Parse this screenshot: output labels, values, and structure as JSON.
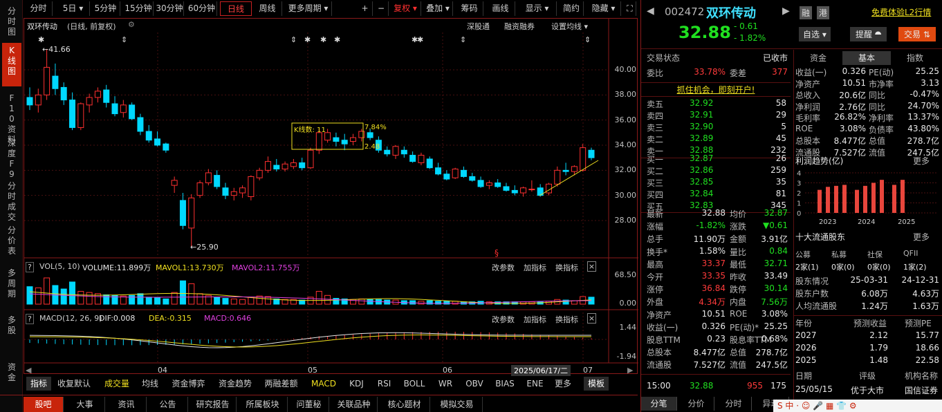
{
  "left_tabs": [
    "分时图",
    "K线图",
    "F10资料",
    "深度F9",
    "分时成交",
    "分价表",
    "多周期",
    "多股",
    "资金"
  ],
  "toolbar": {
    "items": [
      "分时",
      "5日 ▾",
      "5分钟",
      "15分钟",
      "30分钟",
      "60分钟",
      "日线",
      "周线",
      "更多周期 ▾"
    ],
    "right_items": [
      "+",
      "−",
      "复权 ▾",
      "叠加 ▾",
      "筹码",
      "画线",
      "显示 ▾",
      "简约",
      "隐藏 ▾"
    ]
  },
  "chart": {
    "stock_label": "双环传动",
    "mode_label": "(日线, 前复权)",
    "links": [
      "深股通",
      "融资融券",
      "设置均线 ▾"
    ],
    "high_label": "←41.66",
    "low_label": "←25.90",
    "box_label": "K线数: 11",
    "box_pct": "7.84%",
    "box_low": "2.48",
    "y_labels": [
      "40.00",
      "38.00",
      "36.00",
      "34.00",
      "32.00",
      "30.00",
      "28.00"
    ],
    "vol_header": {
      "prefix": "?",
      "name": "VOL(5, 10)",
      "volume": "VOLUME:11.899万",
      "mavol1": "MAVOL1:13.730万",
      "mavol2": "MAVOL2:11.755万"
    },
    "vol_y": [
      "68.50",
      "0.00"
    ],
    "macd_header": {
      "prefix": "?",
      "name": "MACD(12, 26, 9)",
      "dif": "DIF:0.008",
      "dea": "DEA:-0.315",
      "macd": "MACD:0.646"
    },
    "macd_y": [
      "1.44",
      "-1.94"
    ],
    "sub_links": [
      "改参数",
      "加指标",
      "换指标"
    ],
    "x_labels": [
      "04",
      "05",
      "06",
      "07"
    ],
    "date_box": "2025/06/17/二",
    "section_mark": "§"
  },
  "indicator_tabs": [
    "指标",
    "收复默认",
    "成交量",
    "均线",
    "资金博弈",
    "资金趋势",
    "两融差额",
    "MACD",
    "KDJ",
    "RSI",
    "BOLL",
    "WR",
    "OBV",
    "BIAS",
    "ENE",
    "更多",
    "模板"
  ],
  "nav_tabs": [
    "股吧",
    "大事",
    "资讯",
    "公告",
    "研究报告",
    "所属板块",
    "问董秘",
    "关联品种",
    "核心题材",
    "模拟交易"
  ],
  "quote": {
    "code": "002472",
    "name": "双环传动",
    "price": "32.88",
    "change": "- 0.61",
    "pct": "- 1.82%",
    "badges": [
      "融",
      "港"
    ],
    "l2": "免费体验L2行情",
    "buttons": {
      "watch": "自选 ▾",
      "alert": "提醒 ⯊",
      "trade": "交易 ⇅"
    },
    "status_label": "交易状态",
    "status": "已收市",
    "weibi_label": "委比",
    "weibi": "33.78%",
    "weicha_label": "委差",
    "weicha": "377",
    "promo": "抓住机会，即刻开户!",
    "asks": [
      [
        "卖五",
        "32.92",
        "58"
      ],
      [
        "卖四",
        "32.91",
        "29"
      ],
      [
        "卖三",
        "32.90",
        "5"
      ],
      [
        "卖二",
        "32.89",
        "45"
      ],
      [
        "卖一",
        "32.88",
        "232"
      ]
    ],
    "bids": [
      [
        "买一",
        "32.87",
        "26"
      ],
      [
        "买二",
        "32.86",
        "259"
      ],
      [
        "买三",
        "32.85",
        "35"
      ],
      [
        "买四",
        "32.84",
        "81"
      ],
      [
        "买五",
        "32.83",
        "345"
      ]
    ],
    "stats": [
      [
        "最新",
        "32.88",
        "均价",
        "32.87"
      ],
      [
        "涨幅",
        "-1.82%",
        "涨跌",
        "▼0.61"
      ],
      [
        "总手",
        "11.90万",
        "金额",
        "3.91亿"
      ],
      [
        "换手*",
        "1.58%",
        "量比",
        "0.84"
      ],
      [
        "最高",
        "33.37",
        "最低",
        "32.71"
      ],
      [
        "今开",
        "33.35",
        "昨收",
        "33.49"
      ],
      [
        "涨停",
        "36.84",
        "跌停",
        "30.14"
      ],
      [
        "外盘",
        "4.34万",
        "内盘",
        "7.56万"
      ],
      [
        "净资产",
        "10.51",
        "ROE",
        "3.08%"
      ],
      [
        "收益(一)",
        "0.326",
        "PE(动)*",
        "25.25"
      ],
      [
        "股息TTM",
        "0.23",
        "股息率TTM",
        "0.68%"
      ],
      [
        "总股本",
        "8.477亿",
        "总值",
        "278.7亿"
      ],
      [
        "流通股",
        "7.527亿",
        "流值",
        "247.5亿"
      ]
    ],
    "last_trade": {
      "time": "15:00",
      "price": "32.88",
      "vol": "955",
      "num": "175"
    },
    "bottom_tabs": [
      "分笔",
      "分价",
      "分时",
      "异动"
    ]
  },
  "fund": {
    "tabs": [
      "资金",
      "基本",
      "指数"
    ],
    "rows": [
      [
        "收益(一)",
        "0.326",
        "PE(动)",
        "25.25"
      ],
      [
        "净资产",
        "10.51",
        "市净率",
        "3.13"
      ],
      [
        "总收入",
        "20.6亿",
        "同比",
        "-0.47%"
      ],
      [
        "净利润",
        "2.76亿",
        "同比",
        "24.70%"
      ],
      [
        "毛利率",
        "26.82%",
        "净利率",
        "13.37%"
      ],
      [
        "ROE",
        "3.08%",
        "负债率",
        "43.80%"
      ],
      [
        "总股本",
        "8.477亿",
        "总值",
        "278.7亿"
      ],
      [
        "流通股",
        "7.527亿",
        "流值",
        "247.5亿"
      ]
    ],
    "profit_title": "利润趋势(亿)",
    "more": "更多",
    "profit_chart": {
      "type": "bar",
      "y_ticks": [
        "4",
        "3",
        "2",
        "1",
        "0"
      ],
      "x_labels": [
        "2023",
        "2024",
        "2025"
      ],
      "values": [
        2.3,
        2.6,
        2.7,
        2.8,
        2.3,
        2.7,
        3.0,
        3.3,
        2.8,
        3.3
      ],
      "ylim": [
        0,
        4
      ]
    },
    "holders_title": "十大流通股东",
    "holder_types": [
      "公募",
      "私募",
      "社保",
      "QFII"
    ],
    "holder_vals": [
      "2家(1)",
      "0家(0)",
      "0家(0)",
      "1家(2)"
    ],
    "holder_rows": [
      [
        "股东情况",
        "25-03-31",
        "24-12-31"
      ],
      [
        "股东户数",
        "6.08万",
        "4.63万"
      ],
      [
        "人均流通股",
        "1.24万",
        "1.63万"
      ]
    ],
    "forecast_header": [
      "年份",
      "预测收益",
      "预测PE"
    ],
    "forecast": [
      [
        "2027",
        "2.12",
        "15.77"
      ],
      [
        "2026",
        "1.79",
        "18.66"
      ],
      [
        "2025",
        "1.48",
        "22.58"
      ]
    ],
    "rating_header": [
      "日期",
      "评级",
      "机构名称"
    ],
    "rating": [
      "25/05/15",
      "优于大市",
      "国信证券"
    ]
  }
}
